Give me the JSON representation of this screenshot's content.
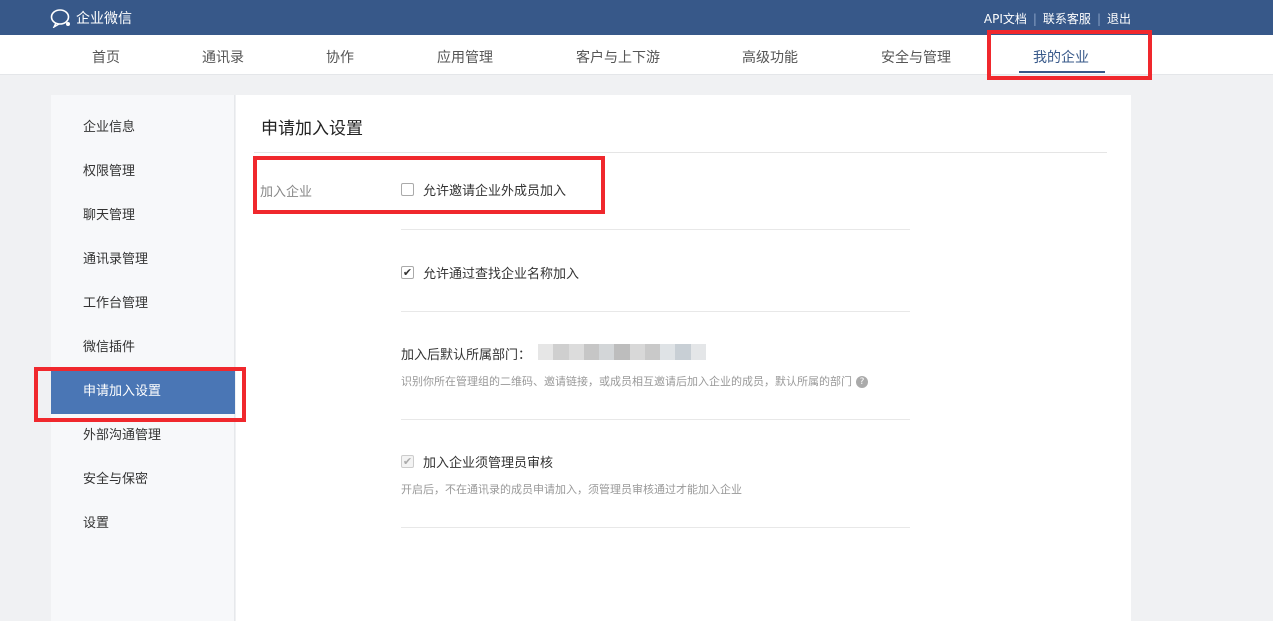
{
  "app": {
    "name": "企业微信"
  },
  "top_links": {
    "api": "API文档",
    "support": "联系客服",
    "logout": "退出",
    "separator": "|"
  },
  "nav": {
    "items": [
      "首页",
      "通讯录",
      "协作",
      "应用管理",
      "客户与上下游",
      "高级功能",
      "安全与管理",
      "我的企业"
    ],
    "active": "我的企业"
  },
  "sidebar": {
    "items": [
      "企业信息",
      "权限管理",
      "聊天管理",
      "通讯录管理",
      "工作台管理",
      "微信插件",
      "申请加入设置",
      "外部沟通管理",
      "安全与保密",
      "设置"
    ],
    "active": "申请加入设置"
  },
  "content": {
    "title": "申请加入设置",
    "row_label": "加入企业",
    "options": [
      {
        "label": "允许邀请企业外成员加入",
        "checked": false
      },
      {
        "label": "允许通过查找企业名称加入",
        "checked": true
      }
    ],
    "dept": {
      "label": "加入后默认所属部门：",
      "hint": "识别你所在管理组的二维码、邀请链接，或成员相互邀请后加入企业的成员，默认所属的部门",
      "help_icon": "?"
    },
    "review": {
      "label": "加入企业须管理员审核",
      "checked": true,
      "disabled": true,
      "hint": "开启后，不在通讯录的成员申请加入，须管理员审核通过才能加入企业"
    }
  },
  "colors": {
    "topbar": "#375889",
    "accent": "#4a76b5",
    "highlight": "#f0282d"
  }
}
